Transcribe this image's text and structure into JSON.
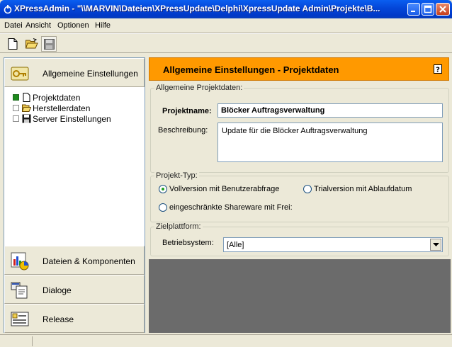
{
  "window": {
    "title": "XPressAdmin - \"\\\\MARVIN\\Dateien\\XPressUpdate\\Delphi\\XpressUpdate Admin\\Projekte\\B..."
  },
  "menu": [
    "Datei",
    "Ansicht",
    "Optionen",
    "Hilfe"
  ],
  "sidebar": {
    "top_button": "Allgemeine Einstellungen",
    "tree": [
      {
        "label": "Projektdaten",
        "checked": true,
        "icon": "document-icon"
      },
      {
        "label": "Herstellerdaten",
        "checked": false,
        "icon": "folder-open-icon"
      },
      {
        "label": "Server Einstellungen",
        "checked": false,
        "icon": "floppy-icon"
      }
    ],
    "bottom_buttons": [
      "Dateien & Komponenten",
      "Dialoge",
      "Release"
    ]
  },
  "content": {
    "header": "Allgemeine Einstellungen - Projektdaten",
    "general_group": {
      "title": "Allgemeine Projektdaten:",
      "project_name_label": "Projektname:",
      "project_name_value": "Blöcker Auftragsverwaltung",
      "description_label": "Beschreibung:",
      "description_value": "Update für die Blöcker Auftragsverwaltung"
    },
    "type_group": {
      "title": "Projekt-Typ:",
      "options": [
        {
          "label": "Vollversion mit Benutzerabfrage",
          "selected": true
        },
        {
          "label": "Trialversion mit Ablaufdatum",
          "selected": false
        },
        {
          "label": "eingeschränkte Shareware mit Frei:",
          "selected": false
        }
      ]
    },
    "platform_group": {
      "title": "Zielplattform:",
      "os_label": "Betriebsystem:",
      "os_value": "[Alle]"
    }
  },
  "colors": {
    "header_bg": "#ff9900",
    "titlebar": "#0446d8"
  }
}
